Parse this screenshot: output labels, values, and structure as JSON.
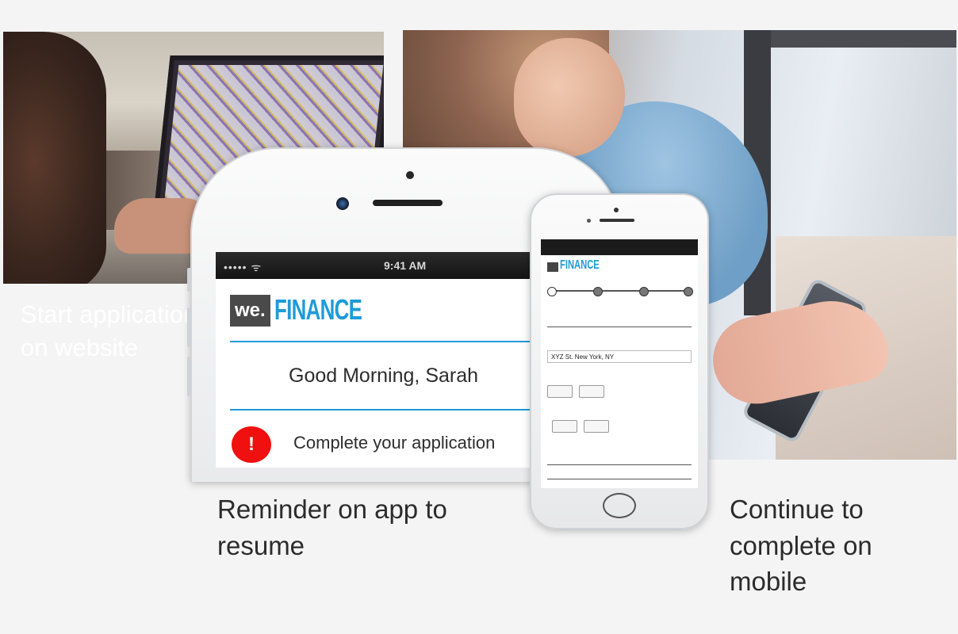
{
  "left_panel": {
    "caption": "Start application on website"
  },
  "middle_panel": {
    "phone_status": {
      "signal": "••••• ᯤ",
      "time": "9:41 AM"
    },
    "brand": {
      "prefix": "we.",
      "name": "FINANCE"
    },
    "greeting": "Good Morning, Sarah",
    "alert_symbol": "!",
    "alert_text": "Complete your application",
    "caption": "Reminder on app to resume"
  },
  "right_panel": {
    "small_phone": {
      "address_value": "XYZ St. New York, NY"
    },
    "caption": "Continue to complete on mobile"
  },
  "colors": {
    "brand_blue": "#1f9bd8",
    "alert_red": "#f01010"
  }
}
